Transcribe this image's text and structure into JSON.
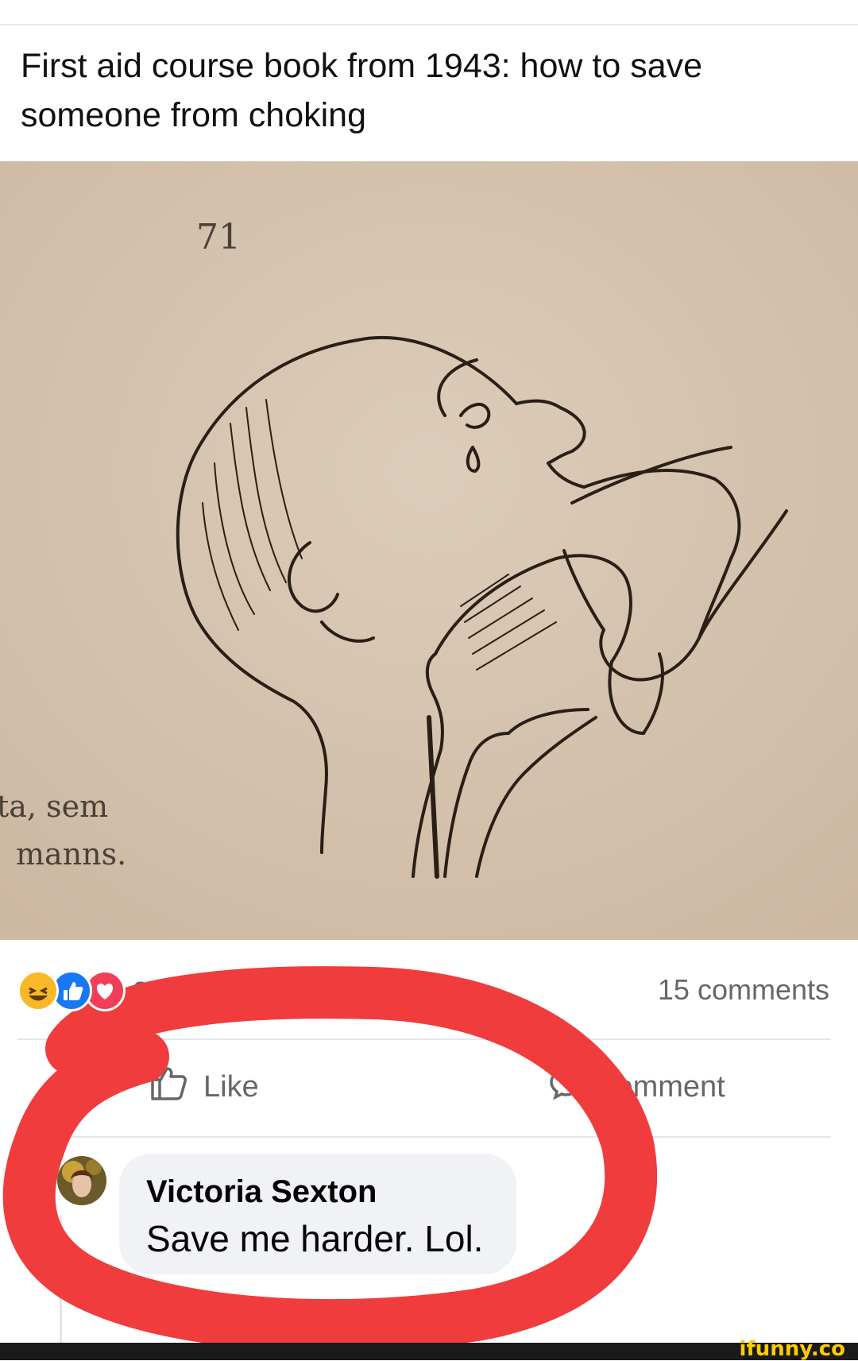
{
  "post": {
    "text": "First aid course book from 1943: how to save someone from choking"
  },
  "photo": {
    "page_number": "71",
    "margin_text_line1": "ta,   sem",
    "margin_text_line2": "manns."
  },
  "reactions": {
    "icons": [
      "haha-icon",
      "like-icon",
      "love-icon"
    ],
    "count": "31"
  },
  "comments_count": "15 comments",
  "actions": {
    "like_label": "Like",
    "comment_label": "Comment"
  },
  "comment": {
    "author": "Victoria Sexton",
    "text": "Save me harder. Lol."
  },
  "watermark": "ifunny.co",
  "colors": {
    "annotation_red": "#f03c3c",
    "meta_gray": "#65676b",
    "like_blue": "#1877f2",
    "love_red": "#f33e58",
    "haha_yellow": "#f7b928",
    "photo_paper": "#d8c6b3"
  }
}
